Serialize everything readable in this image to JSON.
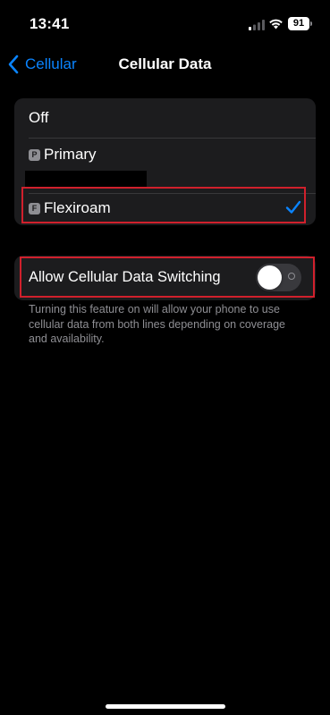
{
  "status_bar": {
    "time": "13:41",
    "battery": "91",
    "icons": [
      "signal-icon",
      "wifi-icon",
      "battery-icon"
    ]
  },
  "nav": {
    "back_label": "Cellular",
    "title": "Cellular Data"
  },
  "options": [
    {
      "label": "Off",
      "selected": false
    },
    {
      "badge": "P",
      "label": "Primary",
      "selected": false
    },
    {
      "badge": "F",
      "label": "Flexiroam",
      "selected": true
    }
  ],
  "switching": {
    "label": "Allow Cellular Data Switching",
    "enabled": false,
    "description": "Turning this feature on will allow your phone to use cellular data from both lines depending on coverage and availability."
  },
  "colors": {
    "accent": "#0a84ff",
    "highlight": "#d0202c",
    "group_bg": "#1c1c1e",
    "secondary_text": "#8e8e93"
  }
}
